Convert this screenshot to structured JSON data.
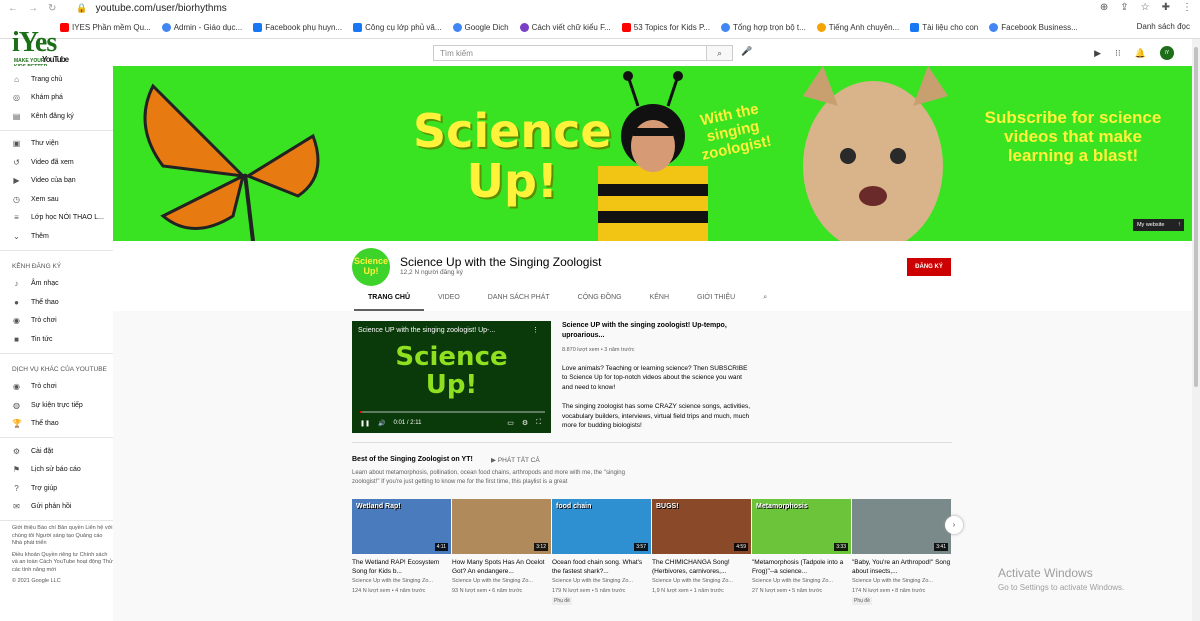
{
  "browser": {
    "url": "youtube.com/user/biorhythms",
    "bookmarks": [
      {
        "label": "IYES Phần mềm Qu...",
        "icon": "yt"
      },
      {
        "label": "Admin - Giáo dục...",
        "icon": "g"
      },
      {
        "label": "Facebook phụ huyn...",
        "icon": "fb"
      },
      {
        "label": "Công cụ lớp phủ vă...",
        "icon": "fb"
      },
      {
        "label": "Google Dich",
        "icon": "g"
      },
      {
        "label": "Cách viết chữ kiểu F...",
        "icon": "p"
      },
      {
        "label": "53 Topics for Kids P...",
        "icon": "yt"
      },
      {
        "label": "Tổng hợp trọn bộ t...",
        "icon": "g"
      },
      {
        "label": "Tiếng Anh chuyên...",
        "icon": "o"
      },
      {
        "label": "Tài liệu cho con",
        "icon": "fb"
      },
      {
        "label": "Facebook Business...",
        "icon": "g"
      }
    ],
    "reading_list": "Danh sách đọc"
  },
  "header": {
    "logo_text": "iYes",
    "logo_tagline": "MAKE YOUR KIDS BETTER",
    "logo_sub": "YouTube",
    "search_placeholder": "Tìm kiếm"
  },
  "sidebar": {
    "main": [
      {
        "label": "Trang chủ",
        "icon": "home-icon"
      },
      {
        "label": "Khám phá",
        "icon": "explore-icon"
      },
      {
        "label": "Kênh đăng ký",
        "icon": "subscriptions-icon"
      }
    ],
    "library": [
      {
        "label": "Thư viện",
        "icon": "library-icon"
      },
      {
        "label": "Video đã xem",
        "icon": "history-icon"
      },
      {
        "label": "Video của bạn",
        "icon": "your-videos-icon"
      },
      {
        "label": "Xem sau",
        "icon": "watch-later-icon"
      },
      {
        "label": "Lớp học NÓI THAO L...",
        "icon": "playlist-icon"
      },
      {
        "label": "Thêm",
        "icon": "chevron-down-icon"
      }
    ],
    "subs_heading": "KÊNH ĐĂNG KÝ",
    "subs": [
      {
        "label": "Âm nhạc",
        "icon": "music-icon"
      },
      {
        "label": "Thể thao",
        "icon": "sports-icon"
      },
      {
        "label": "Trò chơi",
        "icon": "gaming-icon"
      },
      {
        "label": "Tin tức",
        "icon": "news-icon"
      }
    ],
    "more_heading": "DỊCH VỤ KHÁC CỦA YOUTUBE",
    "more": [
      {
        "label": "Trò chơi",
        "icon": "gaming-icon"
      },
      {
        "label": "Sự kiện trực tiếp",
        "icon": "live-icon"
      },
      {
        "label": "Thể thao",
        "icon": "trophy-icon"
      }
    ],
    "settings": [
      {
        "label": "Cài đặt",
        "icon": "gear-icon"
      },
      {
        "label": "Lịch sử báo cáo",
        "icon": "flag-icon"
      },
      {
        "label": "Trợ giúp",
        "icon": "help-icon"
      },
      {
        "label": "Gửi phản hồi",
        "icon": "feedback-icon"
      }
    ],
    "footer1": "Giới thiệu Báo chí Bản quyền Liên hệ với chúng tôi Người sáng tạo Quảng cáo Nhà phát triển",
    "footer2": "Điều khoản Quyền riêng tư Chính sách và an toàn Cách YouTube hoạt động Thử các tính năng mới",
    "copyright": "© 2021 Google LLC"
  },
  "banner": {
    "title_line1": "Science",
    "title_line2": "Up!",
    "singing": "With the singing zoologist!",
    "subscribe": "Subscribe for science videos that make learning a blast!",
    "website": "My website"
  },
  "channel": {
    "avatar_text": "Science Up!",
    "name": "Science Up with the Singing Zoologist",
    "subs": "12,2 N người đăng ký",
    "subscribe_btn": "ĐĂNG KÝ",
    "tabs": [
      "TRANG CHỦ",
      "VIDEO",
      "DANH SÁCH PHÁT",
      "CỘNG ĐỒNG",
      "KÊNH",
      "GIỚI THIỆU"
    ]
  },
  "featured": {
    "player_title": "Science UP with the singing zoologist! Up-...",
    "player_big1": "Science",
    "player_big2": "Up!",
    "time": "0:01 / 2:11",
    "progress": 0.01,
    "title": "Science UP with the singing zoologist! Up-tempo, uproarious...",
    "meta": "8.870 lượt xem • 3 năm trước",
    "desc1": "Love animals? Teaching or learning science? Then SUBSCRIBE to Science Up for top-notch videos about the science you want and need to know!",
    "desc2": "The singing zoologist has some CRAZY science songs, activities, vocabulary builders, interviews, virtual field trips and much, much more for budding biologists!"
  },
  "playlist": {
    "title": "Best of the Singing Zoologist on YT!",
    "play_all": "PHÁT TẤT CẢ",
    "desc": "Learn about metamorphosis, pollination, ocean food chains, arthropods and more with me, the \"singing zoologist!\" If you're just getting to know me for the first time, this playlist is a great",
    "videos": [
      {
        "thumb_label": "Wetland Rap!",
        "duration": "4:11",
        "title": "The Wetland RAP! Ecosystem Song for Kids b...",
        "channel": "Science Up with the Singing Zo...",
        "meta": "124 N lượt xem • 4 năm trước",
        "caption": "",
        "color": "#4a7bbd"
      },
      {
        "thumb_label": "",
        "duration": "3:12",
        "title": "How Many Spots Has An Ocelot Got? An endangere...",
        "channel": "Science Up with the Singing Zo...",
        "meta": "93 N lượt xem • 6 năm trước",
        "caption": "",
        "color": "#b08a5a"
      },
      {
        "thumb_label": "food chain",
        "duration": "3:57",
        "title": "Ocean food chain song. What's the fastest shark?...",
        "channel": "Science Up with the Singing Zo...",
        "meta": "179 N lượt xem • 5 năm trước",
        "caption": "Phụ đề",
        "color": "#2e8fd1"
      },
      {
        "thumb_label": "BUGS!",
        "duration": "4:59",
        "title": "The CHIMICHANGA Song! (Herbivores, carnivores,...",
        "channel": "Science Up with the Singing Zo...",
        "meta": "1,9 N lượt xem • 1 năm trước",
        "caption": "",
        "color": "#8a4a2a"
      },
      {
        "thumb_label": "Metamorphosis",
        "duration": "3:33",
        "title": "\"Metamorphosis (Tadpole into a Frog)\"--a science...",
        "channel": "Science Up with the Singing Zo...",
        "meta": "27 N lượt xem • 5 năm trước",
        "caption": "",
        "color": "#6cc43a"
      },
      {
        "thumb_label": "",
        "duration": "3:41",
        "title": "\"Baby, You're an Arthropod!\" Song about insects,...",
        "channel": "Science Up with the Singing Zo...",
        "meta": "174 N lượt xem • 8 năm trước",
        "caption": "Phụ đề",
        "color": "#7a8a8a"
      }
    ]
  },
  "watermark": {
    "line1": "Activate Windows",
    "line2": "Go to Settings to activate Windows."
  }
}
